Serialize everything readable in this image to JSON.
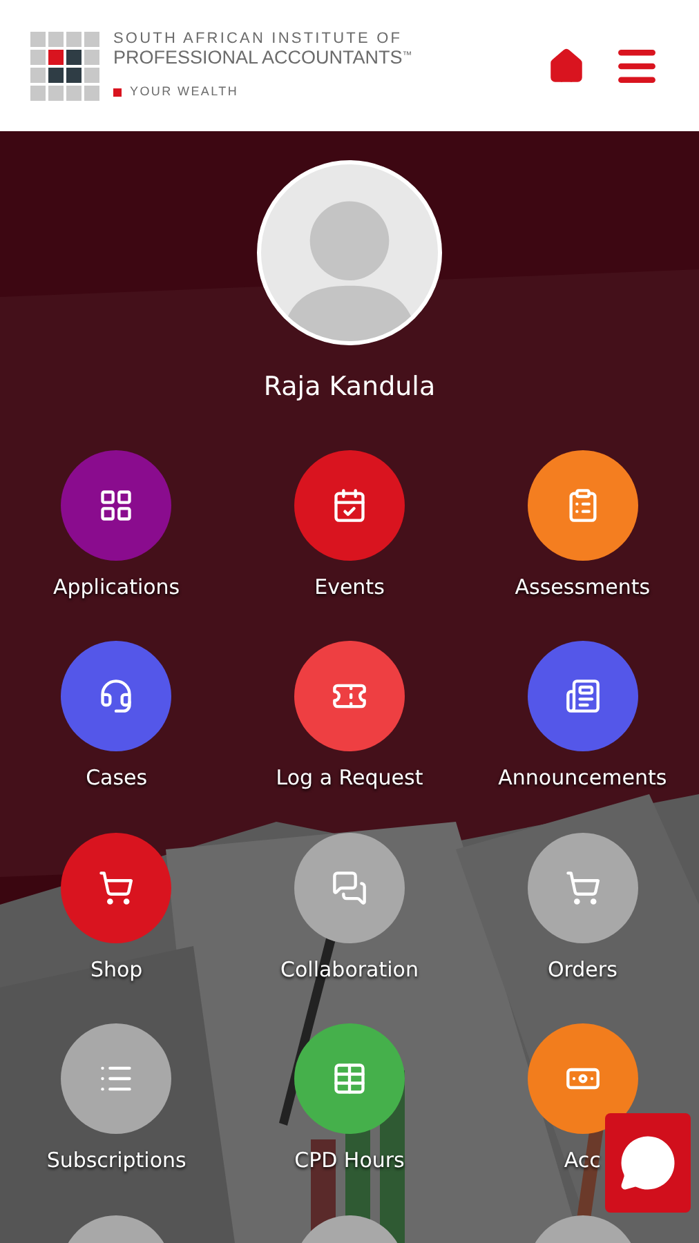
{
  "header": {
    "logo_line_1": "SOUTH AFRICAN INSTITUTE OF",
    "logo_line_2": "PROFESSIONAL ACCOUNTANTS",
    "trademark": "™",
    "tagline": "YOUR WEALTH"
  },
  "profile": {
    "name": "Raja Kandula"
  },
  "tiles": [
    {
      "label": "Applications",
      "color": "#8a0c8e"
    },
    {
      "label": "Events",
      "color": "#d9141f"
    },
    {
      "label": "Assessments",
      "color": "#f47e20"
    },
    {
      "label": "Cases",
      "color": "#5457e9"
    },
    {
      "label": "Log a Request",
      "color": "#ee3f42"
    },
    {
      "label": "Announcements",
      "color": "#5457e9"
    },
    {
      "label": "Shop",
      "color": "#d9141f"
    },
    {
      "label": "Collaboration",
      "color": "#a8a8a8"
    },
    {
      "label": "Orders",
      "color": "#a8a8a8"
    },
    {
      "label": "Subscriptions",
      "color": "#a8a8a8"
    },
    {
      "label": "CPD Hours",
      "color": "#45b04b"
    },
    {
      "label": "Acc",
      "color": "#f27d1d"
    },
    {
      "color": "#a8a8a8"
    },
    {
      "color": "#a8a8a8"
    },
    {
      "color": "#a8a8a8"
    }
  ]
}
